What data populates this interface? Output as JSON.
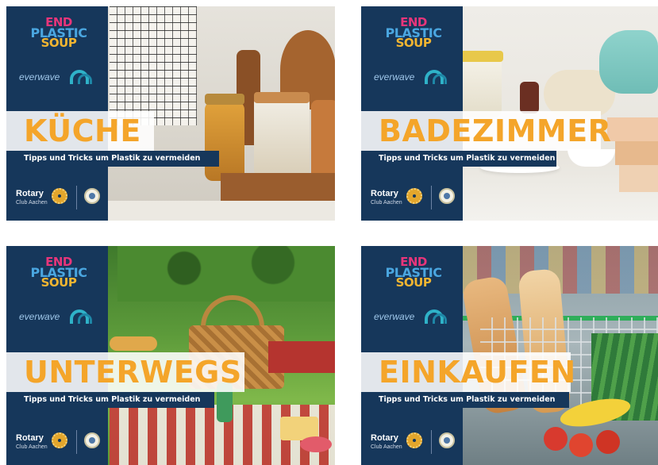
{
  "cards": [
    {
      "title": "KÜCHE",
      "tagline": "Tipps und Tricks um Plastik zu vermeiden",
      "campaign_logo": {
        "line1": "END",
        "line2": "PLASTIC",
        "line3": "SOUP"
      },
      "partner_logo": "everwave",
      "rotary": {
        "name": "Rotary",
        "club": "Club Aachen"
      },
      "scene": "kitchen-jars-scene"
    },
    {
      "title": "BADEZIMMER",
      "tagline": "Tipps und Tricks um Plastik zu vermeiden",
      "campaign_logo": {
        "line1": "END",
        "line2": "PLASTIC",
        "line3": "SOUP"
      },
      "partner_logo": "everwave",
      "rotary": {
        "name": "Rotary",
        "club": "Club Aachen"
      },
      "scene": "bathroom-towels-scene"
    },
    {
      "title": "UNTERWEGS",
      "tagline": "Tipps und Tricks um Plastik zu vermeiden",
      "campaign_logo": {
        "line1": "END",
        "line2": "PLASTIC",
        "line3": "SOUP"
      },
      "partner_logo": "everwave",
      "rotary": {
        "name": "Rotary",
        "club": "Club Aachen"
      },
      "scene": "picnic-basket-scene"
    },
    {
      "title": "EINKAUFEN",
      "tagline": "Tipps und Tricks um Plastik zu vermeiden",
      "campaign_logo": {
        "line1": "END",
        "line2": "PLASTIC",
        "line3": "SOUP"
      },
      "partner_logo": "everwave",
      "rotary": {
        "name": "Rotary",
        "club": "Club Aachen"
      },
      "scene": "shopping-cart-scene"
    }
  ],
  "colors": {
    "sidebar": "#16375b",
    "title": "#f4a52a",
    "eps_pink": "#e8357a",
    "eps_blue": "#4aa6e0",
    "eps_yellow": "#f2b531",
    "rotary_gold": "#e3a62c"
  }
}
